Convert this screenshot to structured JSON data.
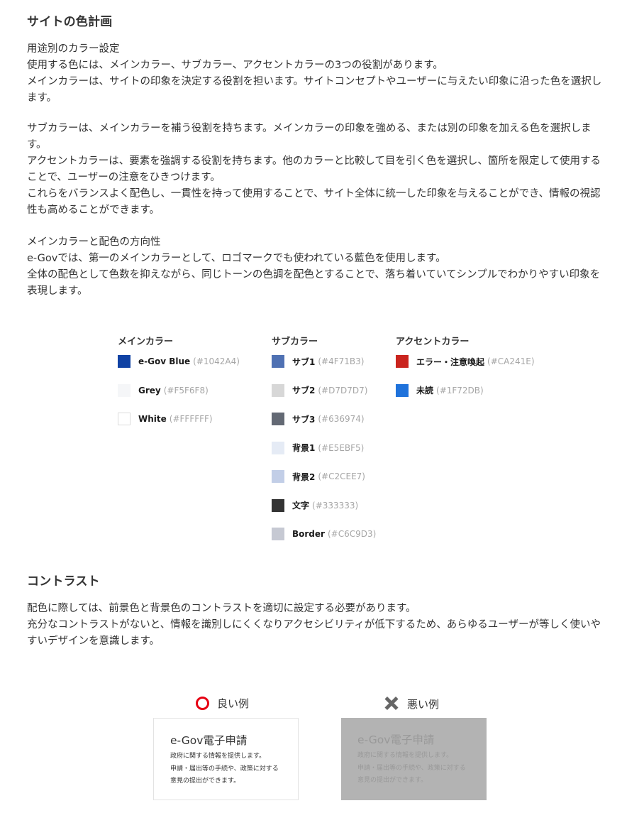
{
  "sections": {
    "color_plan": {
      "heading": "サイトの色計画",
      "block1": [
        "用途別のカラー設定",
        "使用する色には、メインカラー、サブカラー、アクセントカラーの3つの役割があります。",
        "メインカラーは、サイトの印象を決定する役割を担います。サイトコンセプトやユーザーに与えたい印象に沿った色を選択します。"
      ],
      "block2": [
        "サブカラーは、メインカラーを補う役割を持ちます。メインカラーの印象を強める、または別の印象を加える色を選択します。",
        "アクセントカラーは、要素を強調する役割を持ちます。他のカラーと比較して目を引く色を選択し、箇所を限定して使用することで、ユーザーの注意をひきつけます。",
        "これらをバランスよく配色し、一貫性を持って使用することで、サイト全体に統一した印象を与えることができ、情報の視認性も高めることができます。"
      ],
      "block3": [
        "メインカラーと配色の方向性",
        "e-Govでは、第一のメインカラーとして、ロゴマークでも使われている藍色を使用します。",
        "全体の配色として色数を抑えながら、同じトーンの色調を配色とすることで、落ち着いていてシンプルでわかりやすい印象を表現します。"
      ]
    },
    "contrast": {
      "heading": "コントラスト",
      "block": [
        "配色に際しては、前景色と背景色のコントラストを適切に設定する必要があります。",
        "充分なコントラストがないと、情報を識別しにくくなりアクセシビリティが低下するため、あらゆるユーザーが等しく使いやすいデザインを意識します。"
      ]
    }
  },
  "palette": {
    "main": {
      "heading": "メインカラー",
      "items": [
        {
          "name": "e-Gov Blue",
          "hex": "(#1042A4)",
          "color": "#1042A4"
        },
        {
          "name": "Grey",
          "hex": "(#F5F6F8)",
          "color": "#F5F6F8"
        },
        {
          "name": "White",
          "hex": "(#FFFFFF)",
          "color": "#FFFFFF"
        }
      ]
    },
    "sub": {
      "heading": "サブカラー",
      "items": [
        {
          "name": "サブ1",
          "hex": "(#4F71B3)",
          "color": "#4F71B3"
        },
        {
          "name": "サブ2",
          "hex": "(#D7D7D7)",
          "color": "#D7D7D7"
        },
        {
          "name": "サブ3",
          "hex": "(#636974)",
          "color": "#636974"
        },
        {
          "name": "背景1",
          "hex": "(#E5EBF5)",
          "color": "#E5EBF5"
        },
        {
          "name": "背景2",
          "hex": "(#C2CEE7)",
          "color": "#C2CEE7"
        },
        {
          "name": "文字",
          "hex": "(#333333)",
          "color": "#333333"
        },
        {
          "name": "Border",
          "hex": "(#C6C9D3)",
          "color": "#C6C9D3"
        }
      ]
    },
    "accent": {
      "heading": "アクセントカラー",
      "items": [
        {
          "name": "エラー・注意喚起",
          "hex": "(#CA241E)",
          "color": "#CA241E"
        },
        {
          "name": "未読",
          "hex": "(#1F72DB)",
          "color": "#1F72DB"
        }
      ]
    }
  },
  "examples": {
    "good": {
      "label": "良い例",
      "icon": "circle-icon",
      "icon_color": "#E60012",
      "card_title": "e-Gov電子申請",
      "card_lines": [
        "政府に関する情報を提供します。",
        "申請・届出等の手続や、政策に対する",
        "意見の提出ができます。"
      ],
      "bg": "#FFFFFF",
      "fg": "#333333"
    },
    "bad": {
      "label": "悪い例",
      "icon": "cross-icon",
      "icon_color": "#666666",
      "card_title": "e-Gov電子申請",
      "card_lines": [
        "政府に関する情報を提供します。",
        "申請・届出等の手続や、政策に対する",
        "意見の提出ができます。"
      ],
      "bg": "#B3B3B3",
      "fg": "#999999"
    }
  }
}
